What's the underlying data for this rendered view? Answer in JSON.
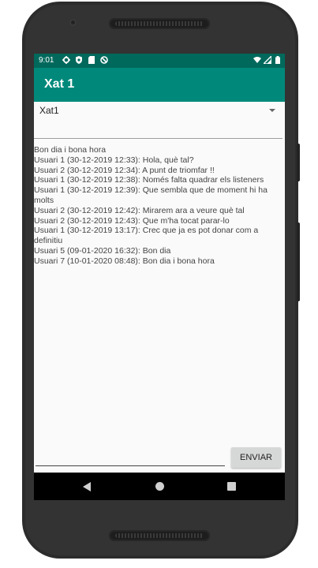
{
  "status_bar": {
    "time": "9:01",
    "left_icons": [
      "gear-icon",
      "shield-icon",
      "sd-card-icon",
      "no-sync-icon"
    ],
    "right_icons": [
      "wifi-icon",
      "signal-icon",
      "battery-icon"
    ]
  },
  "app_bar": {
    "title": "Xat 1"
  },
  "spinner": {
    "selected": "Xat1"
  },
  "log": [
    "Bon dia i bona hora",
    "Usuari 1 (30-12-2019 12:33): Hola, què tal?",
    "Usuari 2 (30-12-2019 12:34): A punt de triomfar !!",
    "Usuari 1 (30-12-2019 12:38): Només falta quadrar els listeners",
    "Usuari 1 (30-12-2019 12:39): Que sembla que de moment hi ha molts",
    "Usuari 2 (30-12-2019 12:42): Mirarem ara a veure què tal",
    "Usuari 2 (30-12-2019 12:43): Que m'ha tocat parar-lo",
    "Usuari 1 (30-12-2019 13:17): Crec que ja es pot donar com a definitiu",
    "Usuari 5 (09-01-2020 16:32): Bon dia",
    "Usuari 7 (10-01-2020 08:48): Bon dia i bona hora"
  ],
  "composer": {
    "value": "",
    "send_label": "ENVIAR"
  },
  "colors": {
    "status_bar": "#00695c",
    "app_bar": "#00897b",
    "background": "#fafafa"
  }
}
